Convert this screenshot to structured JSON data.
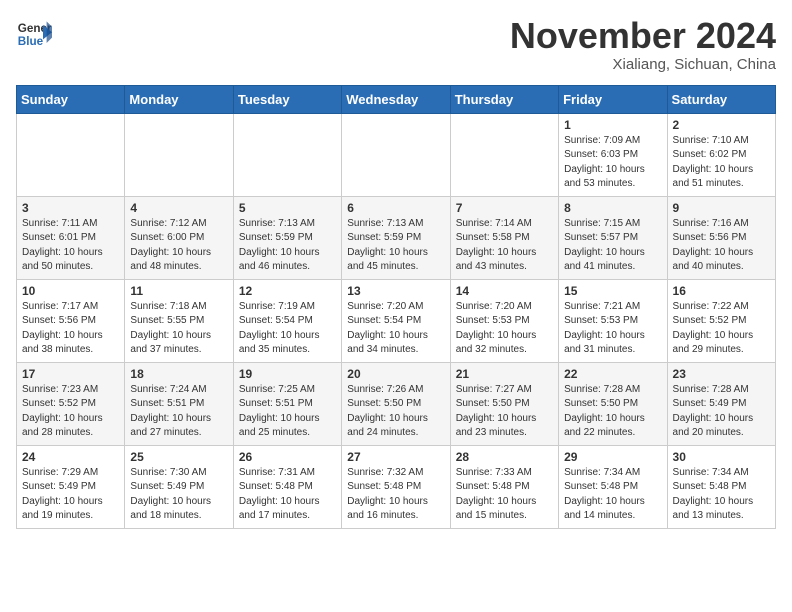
{
  "header": {
    "logo_line1": "General",
    "logo_line2": "Blue",
    "month": "November 2024",
    "location": "Xialiang, Sichuan, China"
  },
  "weekdays": [
    "Sunday",
    "Monday",
    "Tuesday",
    "Wednesday",
    "Thursday",
    "Friday",
    "Saturday"
  ],
  "weeks": [
    [
      {
        "day": "",
        "info": ""
      },
      {
        "day": "",
        "info": ""
      },
      {
        "day": "",
        "info": ""
      },
      {
        "day": "",
        "info": ""
      },
      {
        "day": "",
        "info": ""
      },
      {
        "day": "1",
        "info": "Sunrise: 7:09 AM\nSunset: 6:03 PM\nDaylight: 10 hours and 53 minutes."
      },
      {
        "day": "2",
        "info": "Sunrise: 7:10 AM\nSunset: 6:02 PM\nDaylight: 10 hours and 51 minutes."
      }
    ],
    [
      {
        "day": "3",
        "info": "Sunrise: 7:11 AM\nSunset: 6:01 PM\nDaylight: 10 hours and 50 minutes."
      },
      {
        "day": "4",
        "info": "Sunrise: 7:12 AM\nSunset: 6:00 PM\nDaylight: 10 hours and 48 minutes."
      },
      {
        "day": "5",
        "info": "Sunrise: 7:13 AM\nSunset: 5:59 PM\nDaylight: 10 hours and 46 minutes."
      },
      {
        "day": "6",
        "info": "Sunrise: 7:13 AM\nSunset: 5:59 PM\nDaylight: 10 hours and 45 minutes."
      },
      {
        "day": "7",
        "info": "Sunrise: 7:14 AM\nSunset: 5:58 PM\nDaylight: 10 hours and 43 minutes."
      },
      {
        "day": "8",
        "info": "Sunrise: 7:15 AM\nSunset: 5:57 PM\nDaylight: 10 hours and 41 minutes."
      },
      {
        "day": "9",
        "info": "Sunrise: 7:16 AM\nSunset: 5:56 PM\nDaylight: 10 hours and 40 minutes."
      }
    ],
    [
      {
        "day": "10",
        "info": "Sunrise: 7:17 AM\nSunset: 5:56 PM\nDaylight: 10 hours and 38 minutes."
      },
      {
        "day": "11",
        "info": "Sunrise: 7:18 AM\nSunset: 5:55 PM\nDaylight: 10 hours and 37 minutes."
      },
      {
        "day": "12",
        "info": "Sunrise: 7:19 AM\nSunset: 5:54 PM\nDaylight: 10 hours and 35 minutes."
      },
      {
        "day": "13",
        "info": "Sunrise: 7:20 AM\nSunset: 5:54 PM\nDaylight: 10 hours and 34 minutes."
      },
      {
        "day": "14",
        "info": "Sunrise: 7:20 AM\nSunset: 5:53 PM\nDaylight: 10 hours and 32 minutes."
      },
      {
        "day": "15",
        "info": "Sunrise: 7:21 AM\nSunset: 5:53 PM\nDaylight: 10 hours and 31 minutes."
      },
      {
        "day": "16",
        "info": "Sunrise: 7:22 AM\nSunset: 5:52 PM\nDaylight: 10 hours and 29 minutes."
      }
    ],
    [
      {
        "day": "17",
        "info": "Sunrise: 7:23 AM\nSunset: 5:52 PM\nDaylight: 10 hours and 28 minutes."
      },
      {
        "day": "18",
        "info": "Sunrise: 7:24 AM\nSunset: 5:51 PM\nDaylight: 10 hours and 27 minutes."
      },
      {
        "day": "19",
        "info": "Sunrise: 7:25 AM\nSunset: 5:51 PM\nDaylight: 10 hours and 25 minutes."
      },
      {
        "day": "20",
        "info": "Sunrise: 7:26 AM\nSunset: 5:50 PM\nDaylight: 10 hours and 24 minutes."
      },
      {
        "day": "21",
        "info": "Sunrise: 7:27 AM\nSunset: 5:50 PM\nDaylight: 10 hours and 23 minutes."
      },
      {
        "day": "22",
        "info": "Sunrise: 7:28 AM\nSunset: 5:50 PM\nDaylight: 10 hours and 22 minutes."
      },
      {
        "day": "23",
        "info": "Sunrise: 7:28 AM\nSunset: 5:49 PM\nDaylight: 10 hours and 20 minutes."
      }
    ],
    [
      {
        "day": "24",
        "info": "Sunrise: 7:29 AM\nSunset: 5:49 PM\nDaylight: 10 hours and 19 minutes."
      },
      {
        "day": "25",
        "info": "Sunrise: 7:30 AM\nSunset: 5:49 PM\nDaylight: 10 hours and 18 minutes."
      },
      {
        "day": "26",
        "info": "Sunrise: 7:31 AM\nSunset: 5:48 PM\nDaylight: 10 hours and 17 minutes."
      },
      {
        "day": "27",
        "info": "Sunrise: 7:32 AM\nSunset: 5:48 PM\nDaylight: 10 hours and 16 minutes."
      },
      {
        "day": "28",
        "info": "Sunrise: 7:33 AM\nSunset: 5:48 PM\nDaylight: 10 hours and 15 minutes."
      },
      {
        "day": "29",
        "info": "Sunrise: 7:34 AM\nSunset: 5:48 PM\nDaylight: 10 hours and 14 minutes."
      },
      {
        "day": "30",
        "info": "Sunrise: 7:34 AM\nSunset: 5:48 PM\nDaylight: 10 hours and 13 minutes."
      }
    ]
  ]
}
